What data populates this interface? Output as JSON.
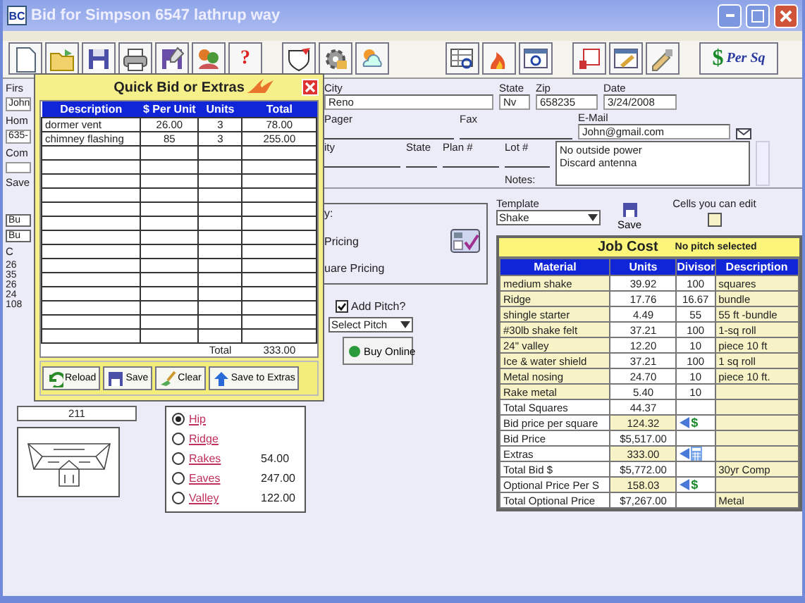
{
  "window": {
    "title": "Bid for Simpson 6547 lathrup way",
    "app_icon": "BC"
  },
  "toolbar": {
    "help_glyph": "?",
    "currency_glyph": "$",
    "per_sq": "Per Sq"
  },
  "left_edge": [
    {
      "text": "Firs",
      "kind": "label"
    },
    {
      "text": "John",
      "kind": "value"
    },
    {
      "text": "Hom",
      "kind": "label"
    },
    {
      "text": "635-",
      "kind": "value"
    },
    {
      "text": "Com",
      "kind": "label"
    },
    {
      "kind": "field"
    },
    {
      "text": "Save",
      "kind": "label"
    }
  ],
  "left_lower": [
    {
      "text": "Bu",
      "kind": "button"
    },
    {
      "text": "Bu",
      "kind": "button"
    },
    {
      "text": "C",
      "kind": "label"
    },
    {
      "text": "26",
      "kind": "number"
    },
    {
      "text": "35",
      "kind": "number"
    },
    {
      "text": "26",
      "kind": "number"
    },
    {
      "text": "24",
      "kind": "number"
    },
    {
      "text": "108",
      "kind": "number"
    }
  ],
  "customer": {
    "city_label": "City",
    "city": "Reno",
    "state_label": "State",
    "state": "Nv",
    "zip_label": "Zip",
    "zip": "658235",
    "date_label": "Date",
    "date": "3/24/2008",
    "pager_label": "Pager",
    "fax_label": "Fax",
    "email_label": "E-Mail",
    "email": "John@gmail.com",
    "job_city_label": "ity",
    "job_state_label": "State",
    "plan_label": "Plan #",
    "lot_label": "Lot #",
    "notes_label": "Notes:",
    "notes": "No outside power\nDiscard antenna"
  },
  "pricing": {
    "heading": "y:",
    "options": [
      "Pricing",
      "uare Pricing"
    ],
    "add_pitch": {
      "label": "Add Pitch?",
      "checked": true
    },
    "pitch_select": "Select Pitch",
    "buy_online": "Buy Online"
  },
  "template": {
    "label": "Template",
    "value": "Shake",
    "save": "Save",
    "cells_hint": "Cells you can edit"
  },
  "job_cost": {
    "title": "Job Cost",
    "pitch_note": "No pitch selected",
    "columns": [
      "Material",
      "Units",
      "Divisor",
      "Description"
    ],
    "rows": [
      {
        "material": "medium shake",
        "units": "39.92",
        "divisor": "100",
        "description": "squares",
        "editable": true
      },
      {
        "material": "Ridge",
        "units": "17.76",
        "divisor": "16.67",
        "description": "bundle",
        "editable": true
      },
      {
        "material": "shingle starter",
        "units": "4.49",
        "divisor": "55",
        "description": "55 ft -bundle",
        "editable": true
      },
      {
        "material": "#30lb shake felt",
        "units": "37.21",
        "divisor": "100",
        "description": "1-sq roll",
        "editable": true
      },
      {
        "material": "24\" valley",
        "units": "12.20",
        "divisor": "10",
        "description": "piece 10 ft",
        "editable": true
      },
      {
        "material": "Ice & water shield",
        "units": "37.21",
        "divisor": "100",
        "description": "1 sq roll",
        "editable": true
      },
      {
        "material": "Metal nosing",
        "units": "24.70",
        "divisor": "10",
        "description": "piece 10 ft.",
        "editable": true
      },
      {
        "material": "Rake metal",
        "units": "5.40",
        "divisor": "10",
        "description": "",
        "editable": true
      },
      {
        "material": "Total Squares",
        "units": "44.37",
        "divisor": "",
        "description": "",
        "editable": false
      },
      {
        "material": "Bid price per square",
        "units": "124.32",
        "divisor": "",
        "description": "",
        "editable": false,
        "units_editable": true,
        "tool": {
          "kind": "price",
          "glyph": "$"
        }
      },
      {
        "material": "Bid Price",
        "units": "$5,517.00",
        "divisor": "",
        "description": "",
        "editable": false
      },
      {
        "material": "Extras",
        "units": "333.00",
        "divisor": "",
        "description": "",
        "editable": false,
        "units_editable": true,
        "tool": {
          "kind": "calculator"
        }
      },
      {
        "material": "Total Bid $",
        "units": "$5,772.00",
        "divisor": "",
        "description": "30yr Comp",
        "editable": false
      },
      {
        "material": "Optional Price Per S",
        "units": "158.03",
        "divisor": "",
        "description": "",
        "editable": false,
        "units_editable": true,
        "tool": {
          "kind": "price",
          "glyph": "$"
        }
      },
      {
        "material": "Total Optional Price",
        "units": "$7,267.00",
        "divisor": "",
        "description": "Metal",
        "editable": false
      }
    ]
  },
  "count_field": "211",
  "roof_sections": [
    {
      "label": "Hip",
      "selected": true
    },
    {
      "label": "Ridge",
      "selected": false
    },
    {
      "label": "Rakes",
      "value": "54.00",
      "selected": false
    },
    {
      "label": "Eaves",
      "value": "247.00",
      "selected": false
    },
    {
      "label": "Valley",
      "value": "122.00",
      "selected": false
    }
  ],
  "quick_bid": {
    "title": "Quick Bid or Extras",
    "columns": [
      "Description",
      "$ Per Unit",
      "Units",
      "Total"
    ],
    "rows": [
      {
        "description": "dormer vent",
        "per_unit": "26.00",
        "units": "3",
        "total": "78.00"
      },
      {
        "description": "chimney flashing",
        "per_unit": "85",
        "units": "3",
        "total": "255.00"
      }
    ],
    "total_label": "Total",
    "total": "333.00",
    "buttons": [
      "Reload",
      "Save",
      "Clear",
      "Save to Extras"
    ]
  }
}
